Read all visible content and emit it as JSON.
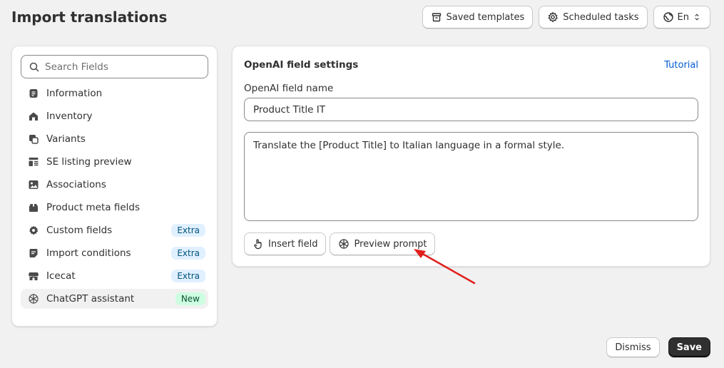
{
  "header": {
    "title": "Import translations",
    "actions": {
      "saved_templates": "Saved templates",
      "scheduled_tasks": "Scheduled tasks",
      "language": "En"
    }
  },
  "sidebar": {
    "search": {
      "placeholder": "Search Fields",
      "value": ""
    },
    "items": [
      {
        "label": "Information",
        "icon": "document-icon"
      },
      {
        "label": "Inventory",
        "icon": "house-icon"
      },
      {
        "label": "Variants",
        "icon": "variants-icon"
      },
      {
        "label": "SE listing preview",
        "icon": "listing-icon"
      },
      {
        "label": "Associations",
        "icon": "image-icon"
      },
      {
        "label": "Product meta fields",
        "icon": "box-icon"
      },
      {
        "label": "Custom fields",
        "icon": "gear-icon",
        "badge": "Extra"
      },
      {
        "label": "Import conditions",
        "icon": "note-icon",
        "badge": "Extra"
      },
      {
        "label": "Icecat",
        "icon": "store-icon",
        "badge": "Extra"
      },
      {
        "label": "ChatGPT assistant",
        "icon": "openai-icon",
        "badge": "New",
        "active": true
      }
    ]
  },
  "settings": {
    "title": "OpenAI field settings",
    "tutorial_link": "Tutorial",
    "field_name_label": "OpenAI field name",
    "field_name_value": "Product Title IT",
    "prompt_value": "Translate the [Product Title] to Italian language in a formal style.",
    "insert_field_button": "Insert field",
    "preview_prompt_button": "Preview prompt"
  },
  "footer": {
    "dismiss": "Dismiss",
    "save": "Save"
  },
  "colors": {
    "accent_link": "#005bd3",
    "primary_button": "#303030",
    "annotation_arrow": "#e0201c",
    "badge_extra_bg": "#e0f0ff",
    "badge_new_bg": "#cdfee1"
  }
}
